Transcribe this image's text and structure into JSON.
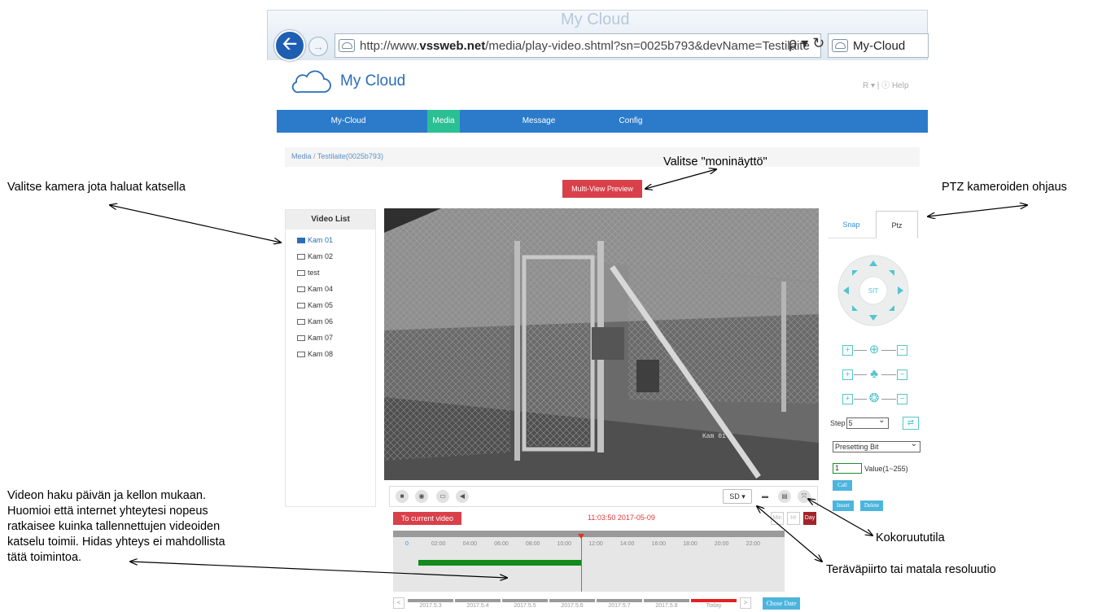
{
  "browser": {
    "watermark": "My Cloud",
    "url_prefix": "http://www.",
    "url_domain": "vssweb.net",
    "url_rest": "/media/play-video.shtml?sn=0025b793&devName=Testilaite",
    "address_tools": "ρ ▾ ↻",
    "tab_title": "My-Cloud",
    "back_icon": "arrow-left-icon",
    "forward_icon": "arrow-right-icon"
  },
  "app": {
    "title": "My Cloud",
    "top_right": "R ▾ | ⓘ Help"
  },
  "nav": {
    "items": [
      {
        "label": "My-Cloud",
        "active": false
      },
      {
        "label": "Media",
        "active": true
      },
      {
        "label": "Message",
        "active": false
      },
      {
        "label": "Config",
        "active": false
      }
    ]
  },
  "breadcrumb": {
    "root": "Media",
    "separator": "/",
    "current": "Testilaite(0025b793)"
  },
  "multi_view_button": "Multi-View Preview",
  "video_list": {
    "title": "Video List",
    "items": [
      {
        "label": "Kam 01",
        "active": true
      },
      {
        "label": "Kam 02",
        "active": false
      },
      {
        "label": "test",
        "active": false
      },
      {
        "label": "Kam 04",
        "active": false
      },
      {
        "label": "Kam 05",
        "active": false
      },
      {
        "label": "Kam 06",
        "active": false
      },
      {
        "label": "Kam 07",
        "active": false
      },
      {
        "label": "Kam 08",
        "active": false
      }
    ]
  },
  "video": {
    "overlay_label": "Kam 01"
  },
  "player_bar": {
    "left_controls": [
      "stop-icon",
      "snapshot-icon",
      "record-icon",
      "mute-icon"
    ],
    "stream_quality": "SD ▾",
    "right_controls": [
      "folder-icon",
      "layout-icon",
      "fullscreen-icon"
    ]
  },
  "playback": {
    "to_current_button": "To current video",
    "current_time": "11:03:50  2017-05-09",
    "zoom": [
      "Min",
      "Hr",
      "Day"
    ],
    "active_zoom": "Day",
    "ticks": [
      "0",
      "02:00",
      "04:00",
      "06:00",
      "08:00",
      "10:00",
      "12:00",
      "14:00",
      "16:00",
      "18:00",
      "20:00",
      "22:00"
    ],
    "recording_start_hour": 0.7,
    "recording_end_hour": 11.06,
    "cursor_hour": 11.06,
    "dates": [
      "2017.5.3",
      "2017.5.4",
      "2017.5.5",
      "2017.5.6",
      "2017.5.7",
      "2017.5.8",
      "Today"
    ],
    "prev": "<",
    "next": ">",
    "choose_date_button": "Chose Date"
  },
  "ptz": {
    "tabs": [
      "Snap",
      "Ptz"
    ],
    "active_tab": "Ptz",
    "center_label": "SIT",
    "step_label": "Step",
    "step_value": "5",
    "preset_select": "Presetting Bit",
    "value_input": "1",
    "value_label": "Value(1~255)",
    "call_button": "Call",
    "insert_button": "Insert",
    "delete_button": "Delete",
    "zoom_rows": [
      "zoom-icon",
      "focus-icon",
      "iris-icon"
    ]
  },
  "annotations": {
    "select_camera": "Valitse kamera jota haluat katsella",
    "multiview": "Valitse \"moninäyttö\"",
    "ptz_control": "PTZ kameroiden ohjaus",
    "search": [
      "Videon haku päivän ja kellon mukaan.",
      "Huomioi että internet yhteytesi nopeus",
      "ratkaisee kuinka tallennettujen videoiden",
      "katselu toimii. Hidas yhteys ei mahdollista",
      "tätä toimintoa."
    ],
    "fullscreen": "Kokoruututila",
    "resolution": "Teräväpiirto tai matala resoluutio"
  },
  "colors": {
    "nav": "#2c7bcb",
    "nav_active": "#2bbf94",
    "accent_red": "#d9404a",
    "recording": "#128a1c",
    "ptz": "#54c4cf"
  }
}
